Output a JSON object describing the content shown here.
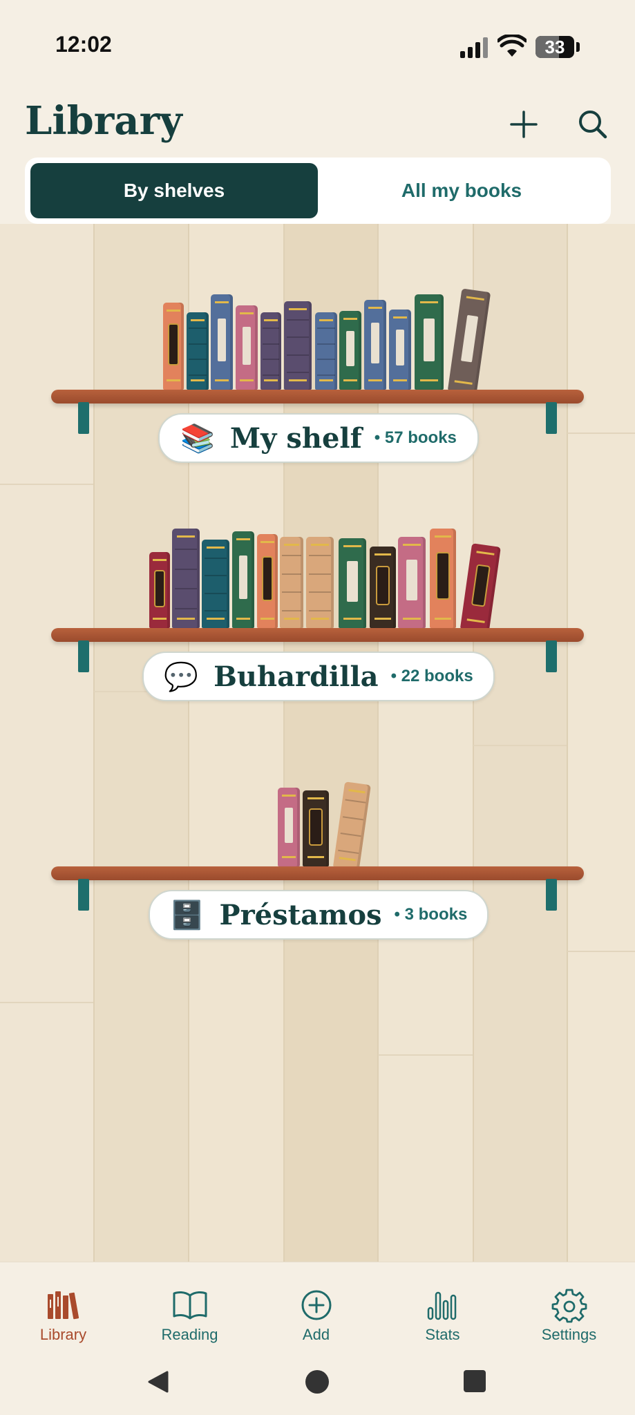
{
  "status_bar": {
    "time": "12:02",
    "battery": "33"
  },
  "header": {
    "title": "Library",
    "add_icon": "plus-icon",
    "search_icon": "search-icon"
  },
  "view_toggle": {
    "options": [
      "By shelves",
      "All my books"
    ],
    "selected": "By shelves"
  },
  "shelves": [
    {
      "emoji": "📚",
      "name": "My shelf",
      "count": "• 57 books"
    },
    {
      "emoji": "💬",
      "name": "Buhardilla",
      "count": "• 22 books"
    },
    {
      "emoji": "🗄️",
      "name": "Préstamos",
      "count": "• 3 books"
    }
  ],
  "bottom_nav": {
    "items": [
      {
        "label": "Library",
        "icon": "library-icon",
        "active": true
      },
      {
        "label": "Reading",
        "icon": "book-open-icon",
        "active": false
      },
      {
        "label": "Add",
        "icon": "plus-circle-icon",
        "active": false
      },
      {
        "label": "Stats",
        "icon": "bar-chart-icon",
        "active": false
      },
      {
        "label": "Settings",
        "icon": "gear-icon",
        "active": false
      }
    ]
  },
  "colors": {
    "accent": "#163f3e",
    "active_tab": "#a94a2c",
    "shelf": "#b8613c",
    "bracket": "#1e6e6c"
  }
}
